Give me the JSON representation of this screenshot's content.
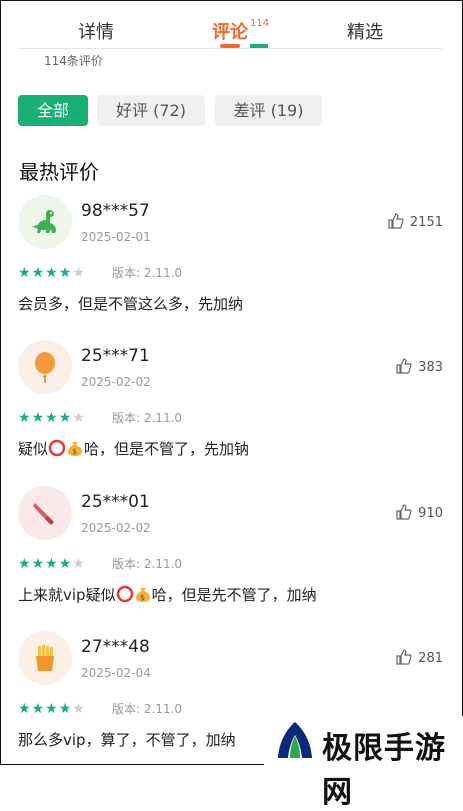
{
  "tabs": {
    "detail": "详情",
    "comments": "评论",
    "comments_count": "114",
    "featured": "精选"
  },
  "review_total": "114条评价",
  "filters": {
    "all": "全部",
    "good": "好评 (72)",
    "bad": "差评 (19)"
  },
  "section_title": "最热评价",
  "reviews": [
    {
      "user": "98***57",
      "date": "2025-02-01",
      "likes": "2151",
      "rating": 4,
      "version": "版本: 2.11.0",
      "content": "会员多，但是不管这么多，先加纳",
      "avatar": "dinosaur-icon"
    },
    {
      "user": "25***71",
      "date": "2025-02-02",
      "likes": "383",
      "rating": 4,
      "version": "版本: 2.11.0",
      "content_a": "疑似",
      "content_b": "哈，但是不管了，先加钠",
      "avatar": "balloon-icon"
    },
    {
      "user": "25***01",
      "date": "2025-02-02",
      "likes": "910",
      "rating": 4,
      "version": "版本: 2.11.0",
      "content_a": "上来就vip疑似",
      "content_b": "哈，但是先不管了，加纳",
      "avatar": "knife-icon"
    },
    {
      "user": "27***48",
      "date": "2025-02-04",
      "likes": "281",
      "rating": 4,
      "version": "版本: 2.11.0",
      "content": "那么多vip，算了，不管了，加纳",
      "avatar": "fries-icon"
    }
  ],
  "watermark": {
    "text": "极限手游网"
  },
  "colors": {
    "accent_green": "#18b074",
    "accent_orange": "#f26a2e"
  }
}
